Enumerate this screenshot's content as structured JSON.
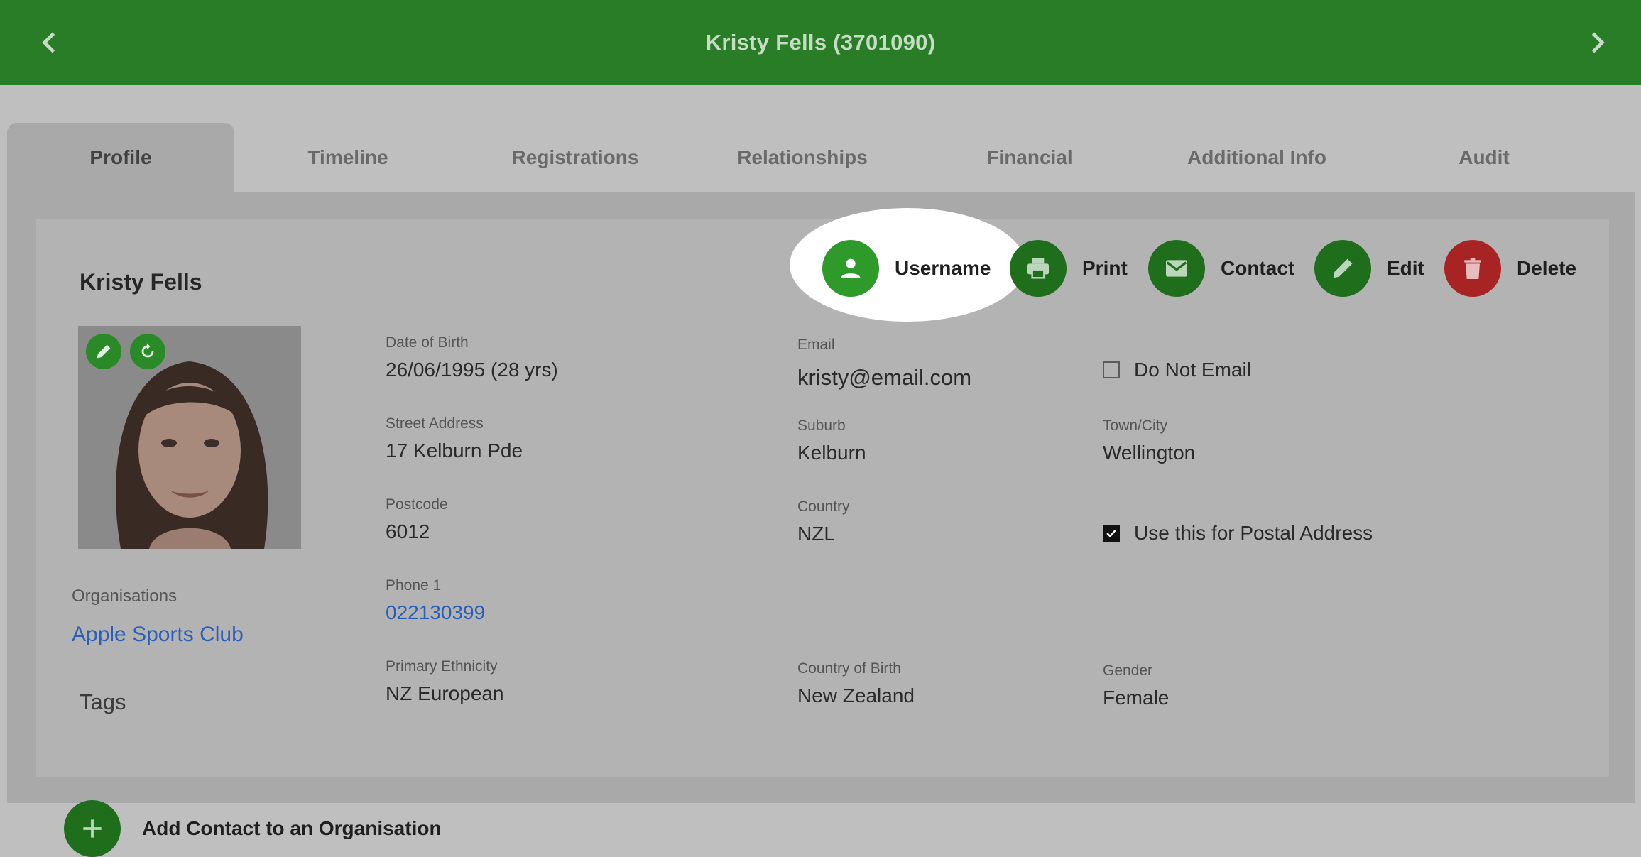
{
  "header": {
    "title": "Kristy Fells (3701090)"
  },
  "tabs": [
    {
      "label": "Profile",
      "active": true
    },
    {
      "label": "Timeline"
    },
    {
      "label": "Registrations"
    },
    {
      "label": "Relationships"
    },
    {
      "label": "Financial"
    },
    {
      "label": "Additional Info"
    },
    {
      "label": "Audit"
    }
  ],
  "profile": {
    "name": "Kristy Fells",
    "actions": {
      "username": "Username",
      "print": "Print",
      "contact": "Contact",
      "edit": "Edit",
      "delete": "Delete"
    },
    "fields": {
      "dob": {
        "label": "Date of Birth",
        "value": "26/06/1995 (28 yrs)"
      },
      "email": {
        "label": "Email",
        "value": "kristy@email.com"
      },
      "do_not_email": {
        "label": "Do Not Email",
        "checked": false
      },
      "street": {
        "label": "Street Address",
        "value": "17 Kelburn Pde"
      },
      "suburb": {
        "label": "Suburb",
        "value": "Kelburn"
      },
      "town": {
        "label": "Town/City",
        "value": "Wellington"
      },
      "postcode": {
        "label": "Postcode",
        "value": "6012"
      },
      "country": {
        "label": "Country",
        "value": "NZL"
      },
      "postal": {
        "label": "Use this for Postal Address",
        "checked": true
      },
      "phone": {
        "label": "Phone 1",
        "value": "022130399"
      },
      "ethnicity": {
        "label": "Primary Ethnicity",
        "value": "NZ European"
      },
      "country_birth": {
        "label": "Country of Birth",
        "value": "New Zealand"
      },
      "gender": {
        "label": "Gender",
        "value": "Female"
      }
    },
    "organisations": {
      "label": "Organisations",
      "value": "Apple Sports Club"
    },
    "tags_label": "Tags",
    "add_contact_label": "Add Contact to an Organisation"
  },
  "colors": {
    "header_green": "#2a7d27",
    "action_green": "#1f6e1c",
    "delete_red": "#a82424",
    "link_blue": "#2a5fb8"
  }
}
